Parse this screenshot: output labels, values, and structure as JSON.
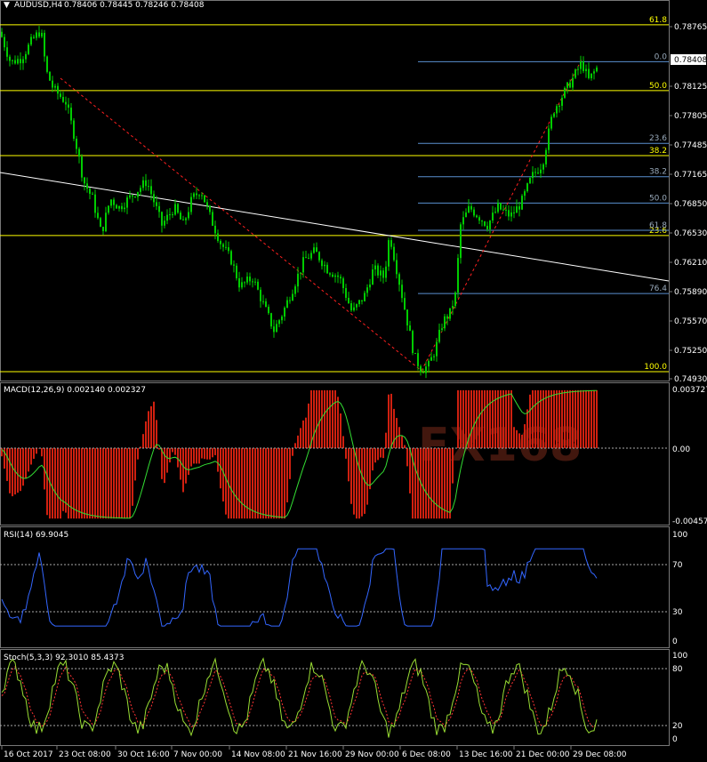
{
  "header": {
    "symbol": "AUDUSD,H4",
    "ohlc": "0.78406 0.78445 0.78246 0.78408",
    "price_box": "0.78408"
  },
  "panes": {
    "macd": {
      "label": "MACD(12,26,9) 0.002140 0.002327",
      "ticks": [
        "0.003727",
        "0.00",
        "-0.004577"
      ]
    },
    "rsi": {
      "label": "RSI(14) 69.9045",
      "ticks": [
        "100",
        "70",
        "30",
        "0"
      ]
    },
    "stoch": {
      "label": "Stoch(5,3,3) 92.3010 85.4373",
      "ticks": [
        "100",
        "80",
        "20",
        "0"
      ]
    }
  },
  "watermark": "FX168",
  "colors": {
    "background": "#000000",
    "bull": "#00cc00",
    "fib_yellow": "#ffff00",
    "fib_blue": "#5a8fcf",
    "macd_hist": "#d02010",
    "signal": "#33dd33",
    "rsi": "#3366ff",
    "stoch_main": "#66cc33",
    "stoch_signal": "#ff3333",
    "trendline": "#ffffff",
    "fib_link": "#ff2020"
  },
  "chart_data": {
    "type": "candlestick",
    "price_ylim": [
      0.7493,
      0.79
    ],
    "y_ticks": [
      "0.78765",
      "0.78408",
      "0.78125",
      "0.77805",
      "0.77485",
      "0.77165",
      "0.76850",
      "0.76530",
      "0.76210",
      "0.75890",
      "0.75570",
      "0.75250",
      "0.74930"
    ],
    "x_labels": [
      "16 Oct 2017",
      "23 Oct 08:00",
      "30 Oct 16:00",
      "7 Nov 00:00",
      "14 Nov 08:00",
      "21 Nov 16:00",
      "29 Nov 00:00",
      "6 Dec 08:00",
      "13 Dec 16:00",
      "21 Dec 00:00",
      "29 Dec 08:00"
    ],
    "close_path": [
      [
        0,
        0.788
      ],
      [
        12,
        0.7845
      ],
      [
        24,
        0.785
      ],
      [
        36,
        0.787
      ],
      [
        46,
        0.7882
      ],
      [
        52,
        0.7835
      ],
      [
        60,
        0.7815
      ],
      [
        74,
        0.78
      ],
      [
        84,
        0.776
      ],
      [
        94,
        0.771
      ],
      [
        104,
        0.769
      ],
      [
        114,
        0.765
      ],
      [
        124,
        0.769
      ],
      [
        134,
        0.768
      ],
      [
        150,
        0.7695
      ],
      [
        165,
        0.771
      ],
      [
        172,
        0.769
      ],
      [
        182,
        0.766
      ],
      [
        196,
        0.768
      ],
      [
        206,
        0.766
      ],
      [
        216,
        0.769
      ],
      [
        226,
        0.77
      ],
      [
        236,
        0.767
      ],
      [
        248,
        0.764
      ],
      [
        260,
        0.762
      ],
      [
        270,
        0.759
      ],
      [
        284,
        0.76
      ],
      [
        296,
        0.757
      ],
      [
        308,
        0.754
      ],
      [
        318,
        0.756
      ],
      [
        330,
        0.759
      ],
      [
        342,
        0.762
      ],
      [
        354,
        0.763
      ],
      [
        368,
        0.761
      ],
      [
        382,
        0.76
      ],
      [
        396,
        0.756
      ],
      [
        410,
        0.758
      ],
      [
        420,
        0.761
      ],
      [
        432,
        0.76
      ],
      [
        438,
        0.765
      ],
      [
        444,
        0.762
      ],
      [
        452,
        0.758
      ],
      [
        460,
        0.754
      ],
      [
        466,
        0.751
      ],
      [
        474,
        0.7495
      ],
      [
        482,
        0.75
      ],
      [
        490,
        0.752
      ],
      [
        498,
        0.755
      ],
      [
        506,
        0.756
      ],
      [
        512,
        0.758
      ],
      [
        518,
        0.766
      ],
      [
        528,
        0.768
      ],
      [
        538,
        0.767
      ],
      [
        548,
        0.766
      ],
      [
        560,
        0.768
      ],
      [
        574,
        0.767
      ],
      [
        586,
        0.7685
      ],
      [
        598,
        0.7715
      ],
      [
        610,
        0.773
      ],
      [
        622,
        0.779
      ],
      [
        634,
        0.781
      ],
      [
        646,
        0.783
      ],
      [
        654,
        0.7845
      ],
      [
        662,
        0.7825
      ],
      [
        672,
        0.784
      ]
    ],
    "fib_yellow": [
      {
        "label": "61.8",
        "price": 0.7888
      },
      {
        "label": "50.0",
        "price": 0.7813
      },
      {
        "label": "38.2",
        "price": 0.7739
      },
      {
        "label": "23.6",
        "price": 0.7648
      },
      {
        "label": "100.0",
        "price": 0.7493
      }
    ],
    "fib_blue": [
      {
        "label": "0.0",
        "price": 0.7846
      },
      {
        "label": "23.6",
        "price": 0.7753
      },
      {
        "label": "38.2",
        "price": 0.7715
      },
      {
        "label": "50.0",
        "price": 0.7685
      },
      {
        "label": "61.8",
        "price": 0.7654
      },
      {
        "label": "76.4",
        "price": 0.7582
      }
    ],
    "rsi_levels": [
      70,
      30
    ],
    "stoch_levels": [
      80,
      20
    ]
  }
}
